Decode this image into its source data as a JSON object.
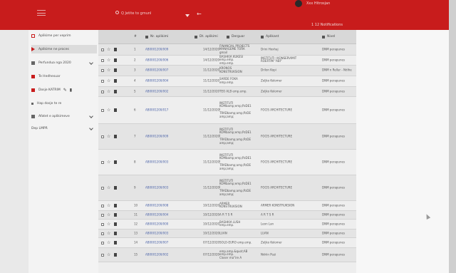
{
  "topbar": {
    "search_placeholder": "Q Jetite to gmunl",
    "user": "Xxx Hitrosjan",
    "notifications": "1 12 Notifications"
  },
  "sidebar": {
    "items": [
      {
        "label": "Aplikime per veprim",
        "icon": "outline-box-icon"
      },
      {
        "label": "Aplikime ne proces",
        "icon": "play-icon"
      },
      {
        "label": "Perfundua nga 2020",
        "icon": "flag-icon"
      },
      {
        "label": "Te Hedhesuar",
        "icon": "box-icon"
      },
      {
        "label": "Dosje KATRIM",
        "icon": "folder-icon"
      },
      {
        "label": "Hap dosje te re",
        "icon": "plus-icon"
      },
      {
        "label": "Afatet e aplikimeve",
        "icon": "grid-icon"
      },
      {
        "label": "Dep LMPR",
        "icon": ""
      }
    ]
  },
  "table": {
    "headers": {
      "num": "#",
      "id": "Nr. aplikimi",
      "date": "Dt. aplikimi",
      "sender": "Derguar",
      "org": "Aplikant",
      "dept": "Nivel"
    },
    "rows": [
      {
        "num": "1",
        "id": "AB0001200/009",
        "date": "14/12/2020",
        "sender": "FINANCIAL PROJECTS\nMANAGEME TORA\ngmail",
        "org": "Drini Hoxhaj",
        "dept": "DNM perapunes"
      },
      {
        "num": "2",
        "id": "AB0001200/006",
        "date": "14/12/2020",
        "sender": "BASHKIA KUKESI\nemp.emp.\nemp.emp.",
        "org": "INSTITUTI I KONSERVIMIT\nROERTIM \"ABI\"",
        "dept": "DNM perapunes"
      },
      {
        "num": "3",
        "id": "AB0001200/007",
        "date": "11/12/2020",
        "sender": "KRONOS\nKONSTRUKSION",
        "org": "Drilon Kopi",
        "dept": "DNM n Rellur - Ndihe"
      },
      {
        "num": "4",
        "id": "AB0001200/004",
        "date": "11/12/2020",
        "sender": "SARDE FOKA\nemp.emp.",
        "org": "Zeljko Kolomer",
        "dept": "DNM perapunes"
      },
      {
        "num": "5",
        "id": "AB0001200/002",
        "date": "11/12/2020",
        "sender": "TEO ALB emp.emp.",
        "org": "Zeljko Kolomer",
        "dept": "DNM perapunes"
      },
      {
        "num": "6",
        "id": "AB0001200/017",
        "date": "11/12/2020",
        "sender": "INSTITUTI\nKOMbamp;emp;PzDE1\nI\nTRADbamp;amp;PzDE\namp;amp;",
        "org": "FOCIS ARCHITECTURE",
        "dept": "DNM perapunes"
      },
      {
        "num": "7",
        "id": "AB0001200/009",
        "date": "11/12/2020",
        "sender": "INSTITUTI\nKOMbamp;emp;PzDE1\nI\nTRADbamp;amp;PzDE\namp;amp;",
        "org": "FOCIS ARCHITECTURE",
        "dept": "DNM perapunes"
      },
      {
        "num": "8",
        "id": "AB0001200/003",
        "date": "11/12/2020",
        "sender": "INSTITUTI\nKOMbamp;emp;PzDE1\nI\nTRADbamp;amp;PzDE\namp;amp;",
        "org": "FOCIS ARCHITECTURE",
        "dept": "DNM perapunes"
      },
      {
        "num": "9",
        "id": "AB0001200/003",
        "date": "11/12/2020",
        "sender": "INSTITUTI\nKOMbamp;emp;PzDE1\nI\nTRADbamp;amp;PzDE\namp;amp;",
        "org": "FOCIS ARCHITECTURE",
        "dept": "DNM perapunes"
      },
      {
        "num": "10",
        "id": "AB0001200/008",
        "date": "10/12/2020",
        "sender": "ARMER\nKONSTRUKSION",
        "org": "ARMER KONSTRUKSION",
        "dept": "DNM perapunes"
      },
      {
        "num": "11",
        "id": "AB0001200/004",
        "date": "10/12/2020",
        "sender": "A R T S R",
        "org": "A R T S R",
        "dept": "DNM perapunes"
      },
      {
        "num": "12",
        "id": "AB0001200/000",
        "date": "10/12/2020",
        "sender": "BASHKIA LUSH\nemp.emp.",
        "org": "Leon Lan",
        "dept": "DNM perapunes"
      },
      {
        "num": "13",
        "id": "AB0001200/003",
        "date": "10/12/2020",
        "sender": "LUAN",
        "org": "LUAN",
        "dept": "DNM perapunes"
      },
      {
        "num": "14",
        "id": "AB0001200/007",
        "date": "07/12/2020",
        "sender": "SOLO-EURO emp.emp.",
        "org": "Zeljko Kolomer",
        "dept": "DNM perapunes"
      },
      {
        "num": "15",
        "id": "AB0001200/002",
        "date": "07/12/2020",
        "sender": "emp.amp.&quot;AB\nemp.emp.\nCloser ma\"ire A",
        "org": "Ndriin Puzi",
        "dept": "DNM perapunes"
      }
    ]
  }
}
